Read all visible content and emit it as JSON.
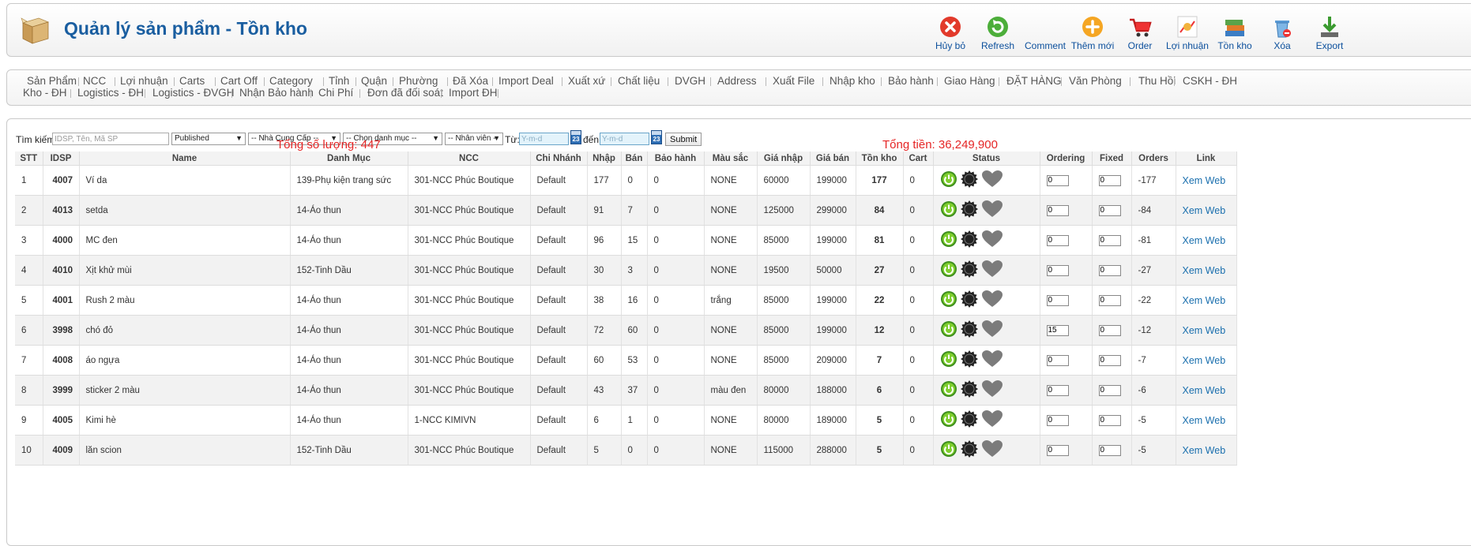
{
  "header": {
    "title": "Quản lý sản phẩm - Tồn kho",
    "toolbar": [
      {
        "id": "cancel",
        "label": "Hủy bỏ",
        "icon": "cancel-icon"
      },
      {
        "id": "refresh",
        "label": "Refresh",
        "icon": "refresh-icon"
      },
      {
        "id": "comment",
        "label": "Comment",
        "icon": "comment-icon"
      },
      {
        "id": "add",
        "label": "Thêm mới",
        "icon": "plus-icon"
      },
      {
        "id": "order",
        "label": "Order",
        "icon": "cart-icon"
      },
      {
        "id": "profit",
        "label": "Lợi nhuận",
        "icon": "profit-icon"
      },
      {
        "id": "stock",
        "label": "Tồn kho",
        "icon": "books-icon"
      },
      {
        "id": "delete",
        "label": "Xóa",
        "icon": "trash-icon"
      },
      {
        "id": "export",
        "label": "Export",
        "icon": "download-icon"
      }
    ]
  },
  "nav": {
    "row1": [
      "Sản Phẩm",
      "NCC",
      "Lợi nhuận",
      "Carts",
      "Cart Off",
      "Category",
      "Tỉnh",
      "Quận",
      "Phường",
      "Đã Xóa",
      "Import Deal",
      "Xuất xứ",
      "Chất liệu",
      "DVGH",
      "Address",
      "Xuất File",
      "Nhập kho",
      "Bảo hành",
      "Giao Hàng",
      "ĐẶT HÀNG",
      "Văn Phòng",
      "Thu Hồi",
      "CSKH - ĐH"
    ],
    "row2": [
      "Kho - ĐH",
      "Logistics - ĐH",
      "Logistics - ĐVGH",
      "Nhận Bảo hành",
      "Chi Phí",
      "Đơn đã đối soát",
      "Import ĐH"
    ]
  },
  "search": {
    "label": "Tìm kiếm:",
    "placeholder": "IDSP, Tên, Mã SP",
    "state": "Published",
    "supplier": "-- Nhà Cung Cấp --",
    "category": "-- Chọn danh mục --",
    "staff": "-- Nhân viên --",
    "from_label": "Từ:",
    "to_label": "đến:",
    "date_placeholder": "Y-m-d",
    "calendar_day": "23",
    "submit": "Submit"
  },
  "totals": {
    "quantity": "Tổng số lượng: 447",
    "money": "Tổng tiền: 36,249,900"
  },
  "table": {
    "columns": [
      "STT",
      "IDSP",
      "Name",
      "Danh Mục",
      "NCC",
      "Chi Nhánh",
      "Nhập",
      "Bán",
      "Bảo hành",
      "Màu sắc",
      "Giá nhập",
      "Giá bán",
      "Tồn kho",
      "Cart",
      "Status",
      "Ordering",
      "Fixed",
      "Orders",
      "Link"
    ],
    "link_text": "Xem Web",
    "rows": [
      {
        "stt": "1",
        "idsp": "4007",
        "name": "Ví da",
        "category": "139-Phụ kiện trang sức",
        "ncc": "301-NCC Phúc Boutique",
        "branch": "Default",
        "nhap": "177",
        "ban": "0",
        "warranty": "0",
        "color": "NONE",
        "cost": "60000",
        "price": "199000",
        "stock": "177",
        "cart": "0",
        "ordering": "0",
        "fixed": "0",
        "orders": "-177"
      },
      {
        "stt": "2",
        "idsp": "4013",
        "name": "setda",
        "category": "14-Áo thun",
        "ncc": "301-NCC Phúc Boutique",
        "branch": "Default",
        "nhap": "91",
        "ban": "7",
        "warranty": "0",
        "color": "NONE",
        "cost": "125000",
        "price": "299000",
        "stock": "84",
        "cart": "0",
        "ordering": "0",
        "fixed": "0",
        "orders": "-84"
      },
      {
        "stt": "3",
        "idsp": "4000",
        "name": "MC đen",
        "category": "14-Áo thun",
        "ncc": "301-NCC Phúc Boutique",
        "branch": "Default",
        "nhap": "96",
        "ban": "15",
        "warranty": "0",
        "color": "NONE",
        "cost": "85000",
        "price": "199000",
        "stock": "81",
        "cart": "0",
        "ordering": "0",
        "fixed": "0",
        "orders": "-81"
      },
      {
        "stt": "4",
        "idsp": "4010",
        "name": "Xịt khử mùi",
        "category": "152-Tinh Dầu",
        "ncc": "301-NCC Phúc Boutique",
        "branch": "Default",
        "nhap": "30",
        "ban": "3",
        "warranty": "0",
        "color": "NONE",
        "cost": "19500",
        "price": "50000",
        "stock": "27",
        "cart": "0",
        "ordering": "0",
        "fixed": "0",
        "orders": "-27"
      },
      {
        "stt": "5",
        "idsp": "4001",
        "name": "Rush 2 màu",
        "category": "14-Áo thun",
        "ncc": "301-NCC Phúc Boutique",
        "branch": "Default",
        "nhap": "38",
        "ban": "16",
        "warranty": "0",
        "color": "trắng",
        "cost": "85000",
        "price": "199000",
        "stock": "22",
        "cart": "0",
        "ordering": "0",
        "fixed": "0",
        "orders": "-22"
      },
      {
        "stt": "6",
        "idsp": "3998",
        "name": "chó đỏ",
        "category": "14-Áo thun",
        "ncc": "301-NCC Phúc Boutique",
        "branch": "Default",
        "nhap": "72",
        "ban": "60",
        "warranty": "0",
        "color": "NONE",
        "cost": "85000",
        "price": "199000",
        "stock": "12",
        "cart": "0",
        "ordering": "15",
        "fixed": "0",
        "orders": "-12"
      },
      {
        "stt": "7",
        "idsp": "4008",
        "name": "áo ngựa",
        "category": "14-Áo thun",
        "ncc": "301-NCC Phúc Boutique",
        "branch": "Default",
        "nhap": "60",
        "ban": "53",
        "warranty": "0",
        "color": "NONE",
        "cost": "85000",
        "price": "209000",
        "stock": "7",
        "cart": "0",
        "ordering": "0",
        "fixed": "0",
        "orders": "-7"
      },
      {
        "stt": "8",
        "idsp": "3999",
        "name": "sticker 2 màu",
        "category": "14-Áo thun",
        "ncc": "301-NCC Phúc Boutique",
        "branch": "Default",
        "nhap": "43",
        "ban": "37",
        "warranty": "0",
        "color": "màu đen",
        "cost": "80000",
        "price": "188000",
        "stock": "6",
        "cart": "0",
        "ordering": "0",
        "fixed": "0",
        "orders": "-6"
      },
      {
        "stt": "9",
        "idsp": "4005",
        "name": "Kimi hè",
        "category": "14-Áo thun",
        "ncc": "1-NCC KIMIVN",
        "branch": "Default",
        "nhap": "6",
        "ban": "1",
        "warranty": "0",
        "color": "NONE",
        "cost": "80000",
        "price": "189000",
        "stock": "5",
        "cart": "0",
        "ordering": "0",
        "fixed": "0",
        "orders": "-5"
      },
      {
        "stt": "10",
        "idsp": "4009",
        "name": "lăn scion",
        "category": "152-Tinh Dầu",
        "ncc": "301-NCC Phúc Boutique",
        "branch": "Default",
        "nhap": "5",
        "ban": "0",
        "warranty": "0",
        "color": "NONE",
        "cost": "115000",
        "price": "288000",
        "stock": "5",
        "cart": "0",
        "ordering": "0",
        "fixed": "0",
        "orders": "-5"
      }
    ]
  }
}
